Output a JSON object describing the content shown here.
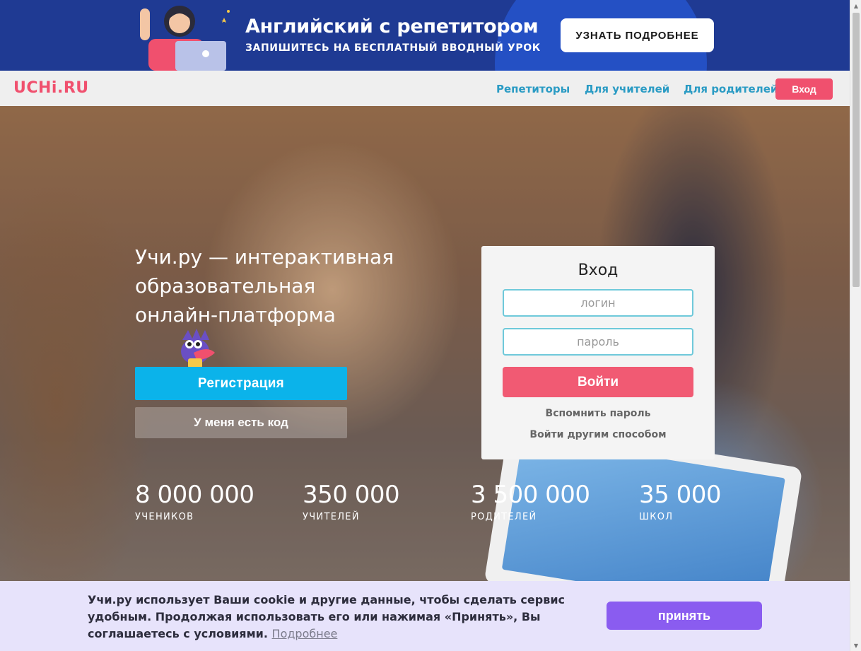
{
  "promo": {
    "title": "Английский с репетитором",
    "subtitle": "ЗАПИШИТЕСЬ НА БЕСПЛАТНЫЙ ВВОДНЫЙ УРОК",
    "button": "УЗНАТЬ ПОДРОБНЕЕ",
    "colors": {
      "background": "#1f3a93",
      "accent": "#2450c4"
    }
  },
  "nav": {
    "logo": "UCHi.RU",
    "links": [
      "Репетиторы",
      "Для учителей",
      "Для родителей"
    ],
    "login": "Вход",
    "colors": {
      "logo": "#f0506e",
      "link": "#2a9bc4",
      "login_bg": "#f0506e"
    }
  },
  "hero": {
    "title_lines": [
      "Учи.ру — интерактивная",
      "образовательная",
      "онлайн-платформа"
    ],
    "register_button": "Регистрация",
    "code_button": "У меня есть код",
    "mascot_icon": "dragon-mascot-icon"
  },
  "login": {
    "title": "Вход",
    "login_placeholder": "логин",
    "password_placeholder": "пароль",
    "submit": "Войти",
    "forgot": "Вспомнить пароль",
    "other": "Войти другим способом",
    "colors": {
      "input_border": "#6fc9da",
      "submit_bg": "#f15a73"
    }
  },
  "stats": [
    {
      "value": "8 000 000",
      "label": "УЧЕНИКОВ"
    },
    {
      "value": "350 000",
      "label": "УЧИТЕЛЕЙ"
    },
    {
      "value": "3 500 000",
      "label": "РОДИТЕЛЕЙ"
    },
    {
      "value": "35 000",
      "label": "ШКОЛ"
    }
  ],
  "cookie": {
    "text": "Учи.ру использует Ваши cookie и другие данные, чтобы сделать сервис удобным. Продолжая использовать его или нажимая «Принять», Вы соглашаетесь с условиями.",
    "link": "Подробнее",
    "button": "принять",
    "colors": {
      "background": "#e7e3fb",
      "button": "#8a5cf0"
    }
  }
}
